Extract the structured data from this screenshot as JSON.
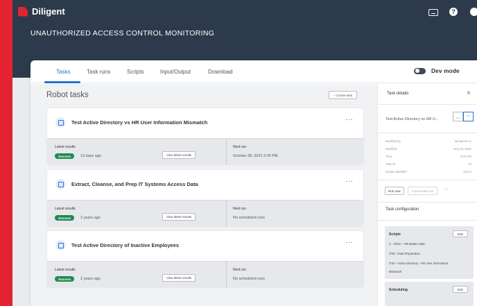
{
  "brand": {
    "name": "Diligent",
    "accent": "#e3232f"
  },
  "header": {
    "title": "UNAUTHORIZED ACCESS CONTROL MONITORING",
    "icons": [
      "keyboard-icon",
      "help-icon",
      "user-icon"
    ],
    "help_glyph": "?"
  },
  "tabs": [
    {
      "label": "Tasks",
      "active": true
    },
    {
      "label": "Task runs"
    },
    {
      "label": "Scripts"
    },
    {
      "label": "Input/Output"
    },
    {
      "label": "Download"
    }
  ],
  "dev_mode": {
    "label": "Dev mode"
  },
  "main": {
    "section_title": "Robot tasks",
    "create_label": "+ Create task",
    "tasks": [
      {
        "name": "Test Active Directory vs HR User Information Mismatch",
        "latest_label": "Latest results",
        "status": "Success",
        "ago": "13 days ago",
        "view_label": "View latest results",
        "next_label": "Next run",
        "next_value": "October 28, 2022 2:00 PM"
      },
      {
        "name": "Extract, Cleanse, and Prep IT Systems Access Data",
        "latest_label": "Latest results",
        "status": "Success",
        "ago": "2 years ago",
        "view_label": "View latest results",
        "next_label": "Next run",
        "next_value": "No scheduled runs"
      },
      {
        "name": "Test Active Directory of Inactive Employees",
        "latest_label": "Latest results",
        "status": "Success",
        "ago": "2 years ago",
        "view_label": "View latest results",
        "next_label": "Next run",
        "next_value": "No scheduled runs"
      }
    ]
  },
  "panel": {
    "title": "Task details",
    "close": "×",
    "task_name": "Test Active Directory vs HR U...",
    "up": "︿",
    "down": "﹀",
    "meta": [
      {
        "label": "Modified by",
        "value": "Benjamin Le"
      },
      {
        "label": "Modified",
        "value": "Sep 23, 2022"
      },
      {
        "label": "Time",
        "value": "8:23 PM"
      },
      {
        "label": "Task ID",
        "value": "10"
      },
      {
        "label": "Unique identifier",
        "value": "14272"
      }
    ],
    "run_now": "Run now",
    "cancel": "Cancel task run",
    "more": "...",
    "config_title": "Task configuration",
    "scripts_title": "Scripts",
    "edit": "Edit",
    "scripts": [
      "C - Other - HR Master data",
      "IT03 - Data Preparation",
      "IT03 - Active Directory - HR User Information",
      "Mismatch"
    ],
    "scheduling_title": "Scheduling"
  },
  "colors": {
    "primary": "#2a6fd1",
    "success": "#1f8a55",
    "header_bg": "#2c3a4b"
  }
}
